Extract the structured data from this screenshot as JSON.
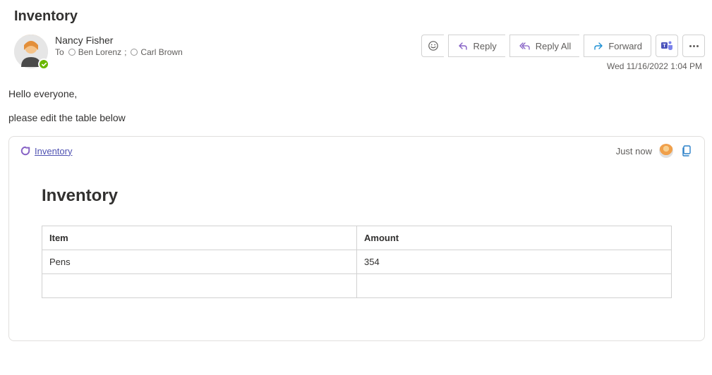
{
  "subject": "Inventory",
  "sender": {
    "name": "Nancy Fisher"
  },
  "recipients": {
    "label": "To",
    "list": [
      {
        "name": "Ben Lorenz",
        "suffix": ";"
      },
      {
        "name": "Carl Brown",
        "suffix": ""
      }
    ]
  },
  "actions": {
    "reply": "Reply",
    "reply_all": "Reply All",
    "forward": "Forward"
  },
  "timestamp": "Wed 11/16/2022 1:04 PM",
  "body": {
    "greeting": "Hello everyone,",
    "line1": "please edit the table below"
  },
  "loop": {
    "link_label": "Inventory",
    "meta_text": "Just now",
    "title": "Inventory",
    "table": {
      "headers": [
        "Item",
        "Amount"
      ],
      "rows": [
        [
          "Pens",
          "354"
        ],
        [
          "",
          ""
        ]
      ]
    }
  }
}
